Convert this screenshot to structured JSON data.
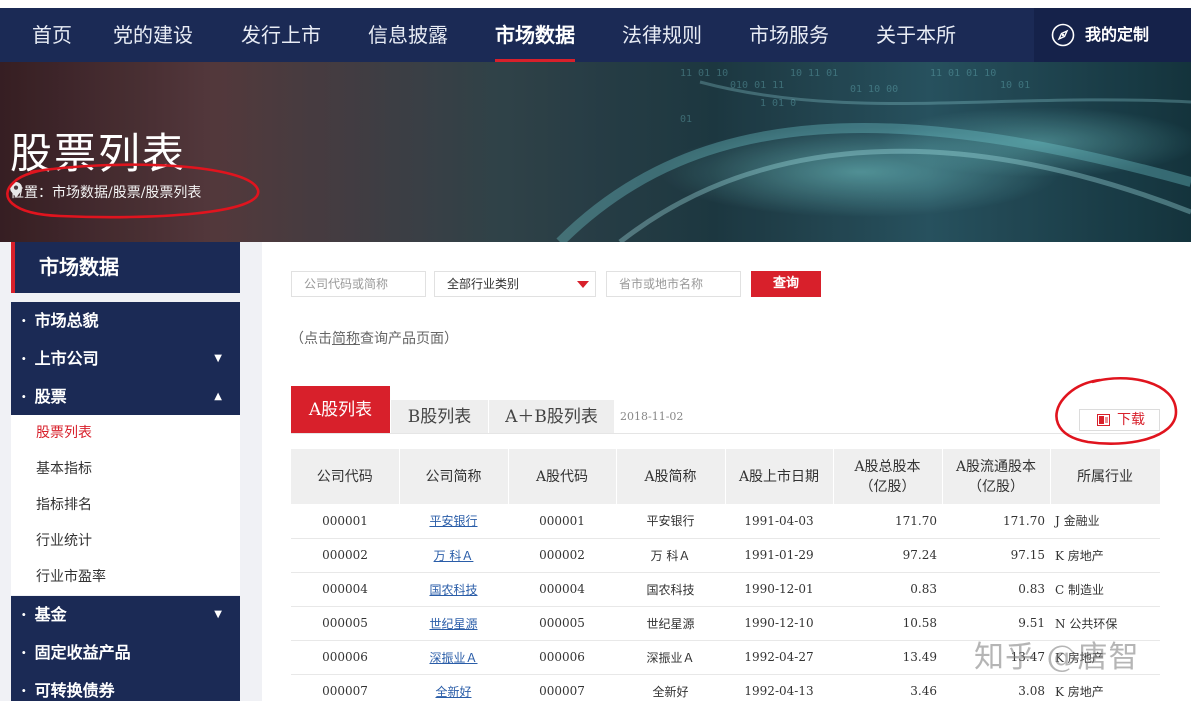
{
  "nav": {
    "items": [
      "首页",
      "党的建设",
      "发行上市",
      "信息披露",
      "市场数据",
      "法律规则",
      "市场服务",
      "关于本所"
    ],
    "active": "市场数据",
    "custom_label": "我的定制"
  },
  "banner": {
    "title": "股票列表",
    "breadcrumb": "位置：市场数据/股票/股票列表"
  },
  "sidebar": {
    "title": "市场数据",
    "sections": {
      "market_overview": "市场总貌",
      "listed_companies": "上市公司",
      "stocks": "股票",
      "funds": "基金",
      "fixed_income": "固定收益产品",
      "convertible": "可转换债券"
    },
    "sub_items": {
      "stock_list": "股票列表",
      "basic_indicators": "基本指标",
      "indicator_ranking": "指标排名",
      "industry_stats": "行业统计",
      "industry_pe": "行业市盈率"
    }
  },
  "search": {
    "code_placeholder": "公司代码或简称",
    "industry_selected": "全部行业类别",
    "region_placeholder": "省市或地市名称",
    "query_label": "查询"
  },
  "hint": {
    "prefix": "（点击",
    "link": "简称",
    "suffix": "查询产品页面）"
  },
  "tabs": {
    "a_list": "A股列表",
    "b_list": "B股列表",
    "ab_list": "A＋B股列表",
    "date": "2018-11-02"
  },
  "download_label": "下载",
  "table": {
    "headers": [
      "公司代码",
      "公司简称",
      "A股代码",
      "A股简称",
      "A股上市日期",
      "A股总股本\n（亿股）",
      "A股流通股本\n（亿股）",
      "所属行业"
    ],
    "rows": [
      [
        "000001",
        "平安银行",
        "000001",
        "平安银行",
        "1991-04-03",
        "171.70",
        "171.70",
        "J 金融业"
      ],
      [
        "000002",
        "万 科Ａ",
        "000002",
        "万 科Ａ",
        "1991-01-29",
        "97.24",
        "97.15",
        "K 房地产"
      ],
      [
        "000004",
        "国农科技",
        "000004",
        "国农科技",
        "1990-12-01",
        "0.83",
        "0.83",
        "C 制造业"
      ],
      [
        "000005",
        "世纪星源",
        "000005",
        "世纪星源",
        "1990-12-10",
        "10.58",
        "9.51",
        "N 公共环保"
      ],
      [
        "000006",
        "深振业Ａ",
        "000006",
        "深振业Ａ",
        "1992-04-27",
        "13.49",
        "13.47",
        "K 房地产"
      ],
      [
        "000007",
        "全新好",
        "000007",
        "全新好",
        "1992-04-13",
        "3.46",
        "3.08",
        "K 房地产"
      ]
    ]
  },
  "watermark": "知乎 @唐智",
  "colors": {
    "nav_bg": "#1b2a55",
    "accent_red": "#d8202b",
    "link_blue": "#2a5da8"
  }
}
